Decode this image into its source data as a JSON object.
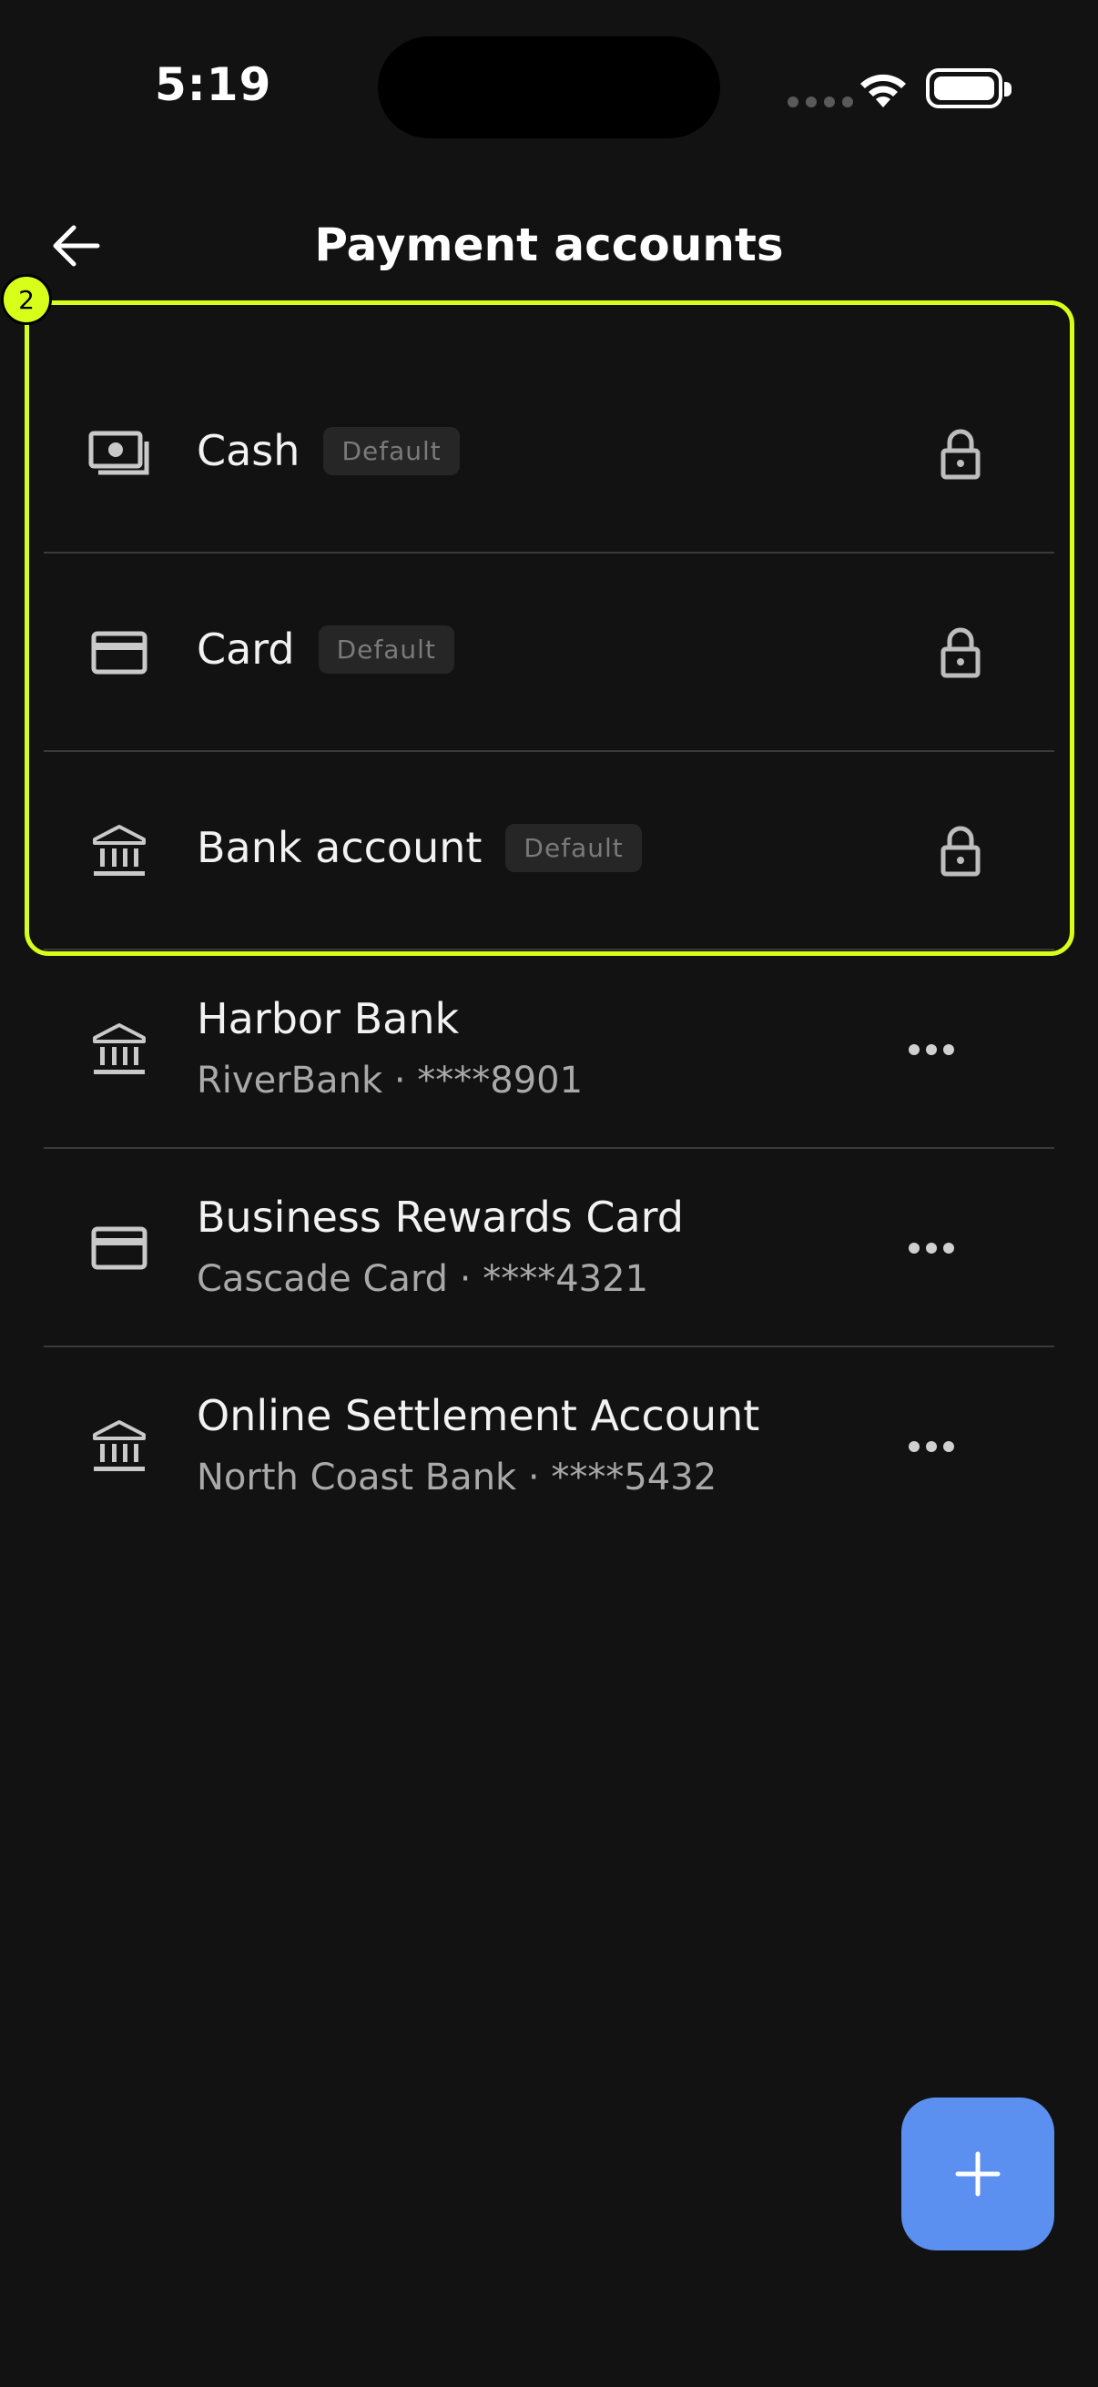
{
  "status_bar": {
    "time": "5:19"
  },
  "header": {
    "title": "Payment accounts"
  },
  "highlight": {
    "label": "2",
    "color": "#d7ff1a"
  },
  "default_accounts": [
    {
      "title": "Cash",
      "badge": "Default",
      "icon": "cash-icon"
    },
    {
      "title": "Card",
      "badge": "Default",
      "icon": "credit-card-icon"
    },
    {
      "title": "Bank account",
      "badge": "Default",
      "icon": "bank-icon"
    }
  ],
  "custom_accounts": [
    {
      "title": "Harbor Bank",
      "subtitle": "RiverBank · ****8901",
      "icon": "bank-icon"
    },
    {
      "title": "Business Rewards Card",
      "subtitle": "Cascade Card · ****4321",
      "icon": "credit-card-icon"
    },
    {
      "title": "Online Settlement Account",
      "subtitle": "North Coast Bank · ****5432",
      "icon": "bank-icon"
    }
  ],
  "colors": {
    "background": "#121212",
    "accent_fab": "#5b8ff0",
    "divider": "#3a3a3a"
  }
}
